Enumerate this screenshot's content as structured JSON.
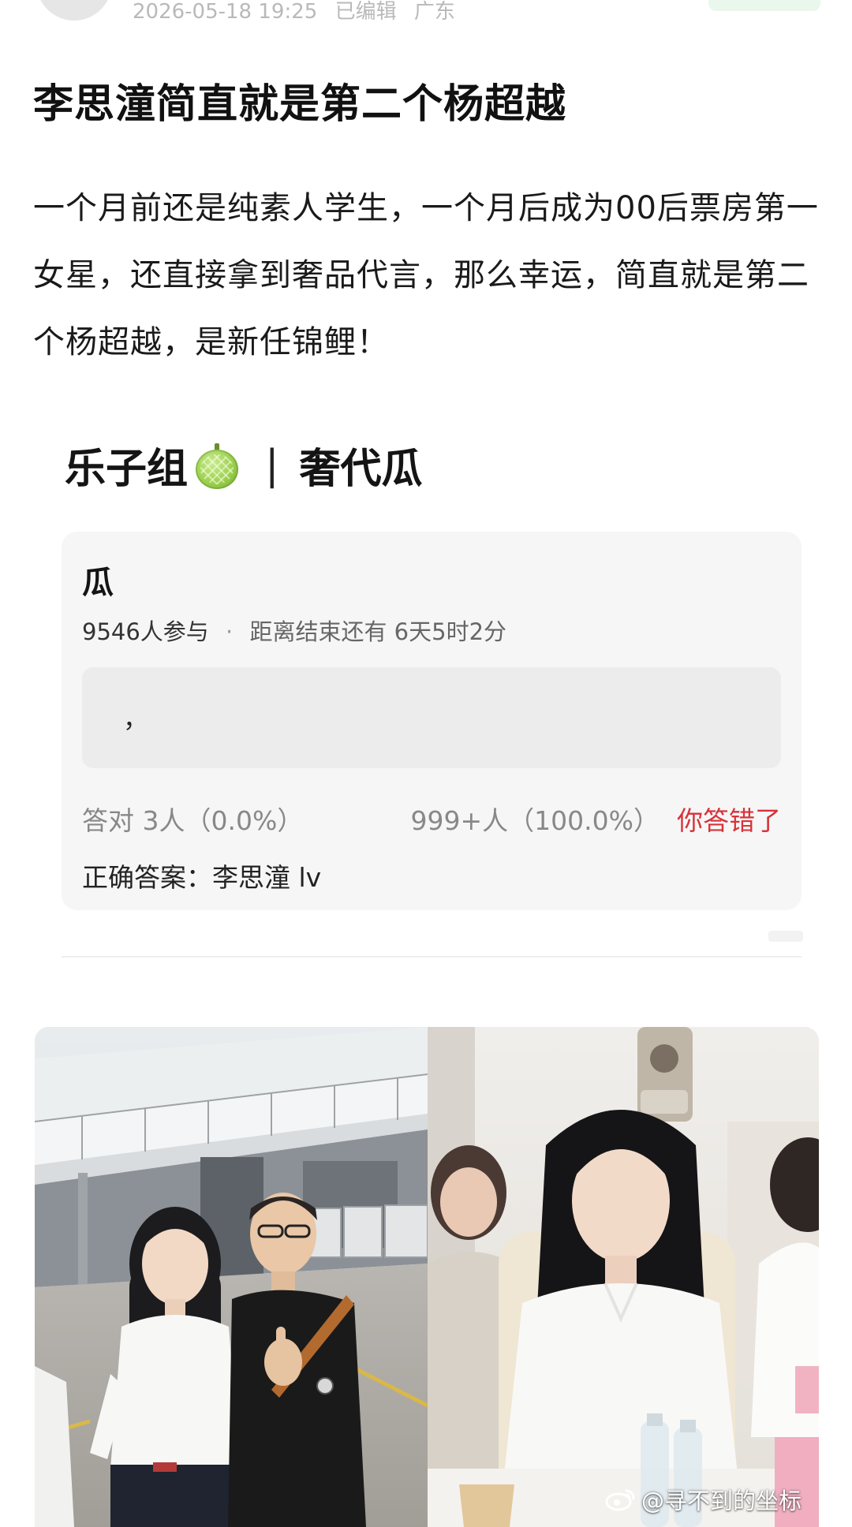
{
  "post": {
    "meta_time": "2026-05-18 19:25",
    "meta_edited": "已编辑",
    "meta_location": "广东",
    "title": "李思潼简直就是第二个杨超越",
    "body": "一个月前还是纯素人学生，一个月后成为00后票房第一女星，还直接拿到奢品代言，那么幸运，简直就是第二个杨超越，是新任锦鲤！"
  },
  "quiz": {
    "group": "乐子组",
    "divider": "|",
    "topic": "奢代瓜",
    "question": "瓜",
    "participants": "9546人参与",
    "dot": "·",
    "countdown": "距离结束还有 6天5时2分",
    "answer_text": "，",
    "correct_stat": "答对  3人（0.0%）",
    "wrong_stat": "999+人（100.0%）",
    "wrong_label": "你答错了",
    "correct_answer": "正确答案：李思潼 lv"
  },
  "watermark": {
    "text": "@寻不到的坐标",
    "icon": "weibo-icon"
  },
  "colors": {
    "wrong": "#d8323a",
    "card_bg": "#f6f6f6",
    "answer_bg": "#ececec"
  }
}
